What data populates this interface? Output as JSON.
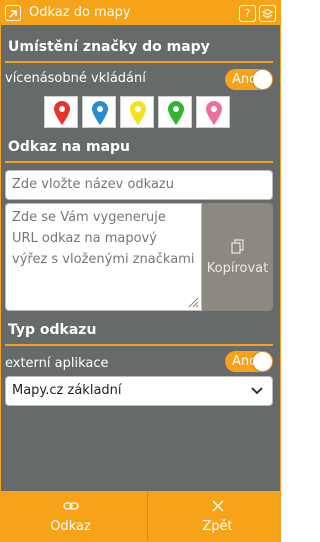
{
  "window": {
    "title": "Odkaz do mapy",
    "help_glyph": "?",
    "accent_color": "#f7a31a",
    "background_color": "#666a6a"
  },
  "markers_section": {
    "title": "Umístění značky do mapy",
    "multi_insert_label": "vícenásobné vkládání",
    "multi_insert_toggle": "Ano",
    "markers": [
      {
        "name": "red-marker",
        "color": "#e8332a"
      },
      {
        "name": "blue-marker",
        "color": "#2a8bd1"
      },
      {
        "name": "yellow-marker",
        "color": "#f3e318"
      },
      {
        "name": "green-marker",
        "color": "#2db52d"
      },
      {
        "name": "pink-marker",
        "color": "#ef6f98"
      }
    ]
  },
  "link_section": {
    "title": "Odkaz na mapu",
    "name_placeholder": "Zde vložte název odkazu",
    "url_placeholder": "Zde se Vám vygeneruje URL odkaz na mapový výřez s vloženými značkami",
    "copy_label": "Kopírovat"
  },
  "type_section": {
    "title": "Typ odkazu",
    "external_app_label": "externí aplikace",
    "external_app_toggle": "Ano",
    "selected_map": "Mapy.cz základní"
  },
  "footer": {
    "link_label": "Odkaz",
    "back_label": "Zpět"
  }
}
